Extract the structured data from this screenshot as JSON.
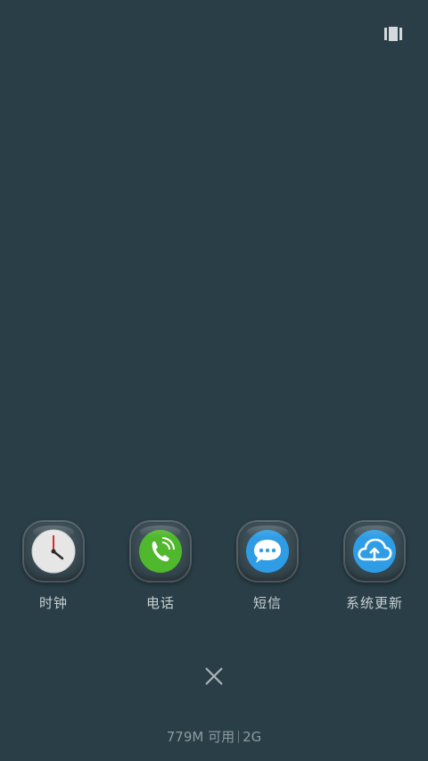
{
  "top_right_icon": "recents-view-toggle-icon",
  "dock": {
    "apps": [
      {
        "label": "时钟",
        "icon": "clock-icon",
        "color": "#e8e8e8"
      },
      {
        "label": "电话",
        "icon": "phone-icon",
        "color": "#4fb82c"
      },
      {
        "label": "短信",
        "icon": "message-icon",
        "color": "#2e9de6"
      },
      {
        "label": "系统更新",
        "icon": "cloud-update-icon",
        "color": "#2e9de6"
      }
    ]
  },
  "close_icon": "close-icon",
  "memory": {
    "available": "779M 可用",
    "total": "2G"
  }
}
